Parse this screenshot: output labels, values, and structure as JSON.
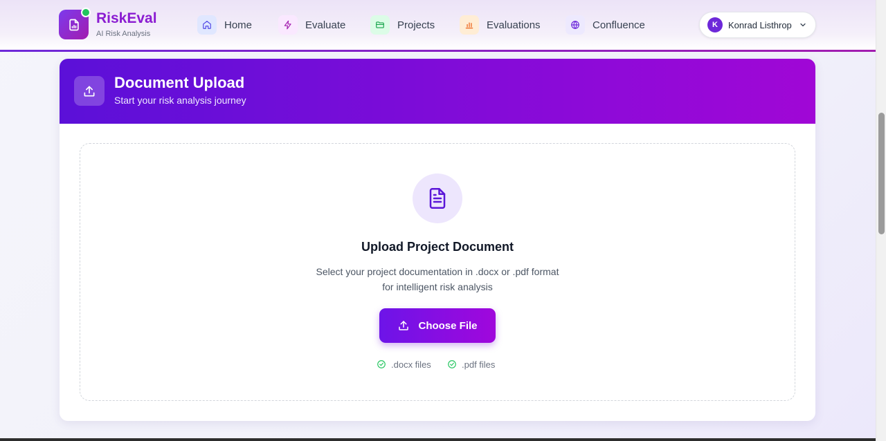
{
  "brand": {
    "title": "RiskEval",
    "subtitle": "AI Risk Analysis"
  },
  "nav": [
    {
      "label": "Home",
      "icon": "home-icon",
      "color": "#4f46e5",
      "bg": "#e0e7ff"
    },
    {
      "label": "Evaluate",
      "icon": "lightning-icon",
      "color": "#a21caf",
      "bg": "#fae8ff"
    },
    {
      "label": "Projects",
      "icon": "folder-icon",
      "color": "#16a34a",
      "bg": "#dcfce7"
    },
    {
      "label": "Evaluations",
      "icon": "bar-chart-icon",
      "color": "#ea580c",
      "bg": "#ffedd5"
    },
    {
      "label": "Confluence",
      "icon": "globe-icon",
      "color": "#6d28d9",
      "bg": "#ede9fe"
    }
  ],
  "user": {
    "initial": "K",
    "name": "Konrad Listhrop"
  },
  "card": {
    "title": "Document Upload",
    "subtitle": "Start your risk analysis journey",
    "upload_title": "Upload Project Document",
    "upload_desc_line1": "Select your project documentation in .docx or .pdf format",
    "upload_desc_line2": "for intelligent risk analysis",
    "button_label": "Choose File",
    "formats": [
      ".docx files",
      ".pdf files"
    ]
  },
  "colors": {
    "accent": "#6d28d9",
    "brand": "#8b1cd1",
    "success": "#22c55e"
  }
}
